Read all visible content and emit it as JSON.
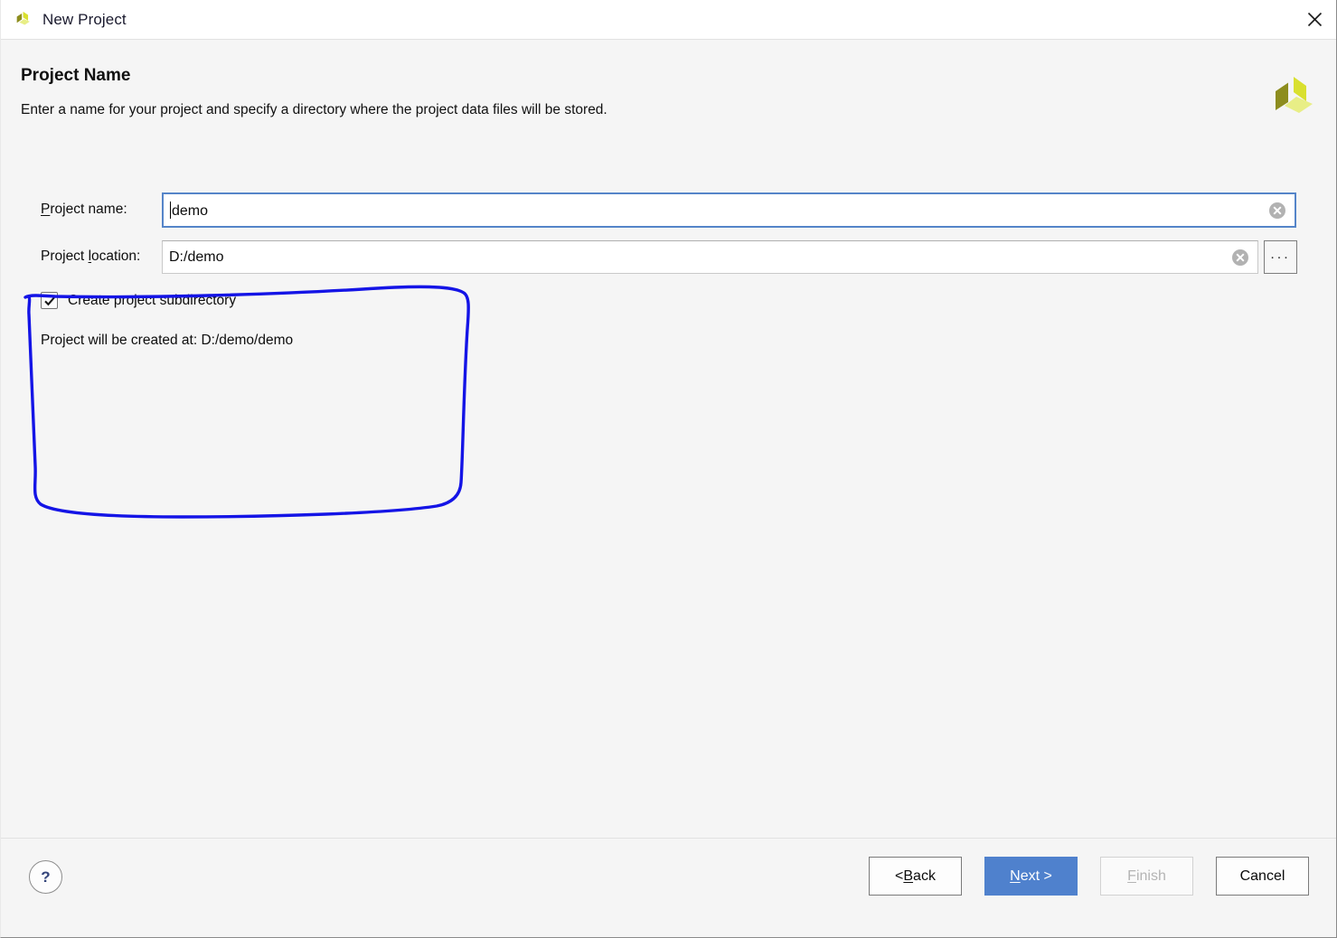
{
  "window": {
    "title": "New Project",
    "icon": "qt-logo-icon",
    "close_icon": "close-icon"
  },
  "header": {
    "title": "Project Name",
    "subtitle": "Enter a name for your project and specify a directory where the project data files will be stored.",
    "brand_icon": "qt-logo-icon"
  },
  "form": {
    "project_name": {
      "label_prefix": "P",
      "label_rest": "roject name:",
      "value": "demo",
      "placeholder": "",
      "clear_icon": "clear-circle-icon",
      "focused": true
    },
    "project_location": {
      "label_prefix_a": "Project ",
      "label_mnemonic": "l",
      "label_rest": "ocation:",
      "value": "D:/demo",
      "placeholder": "",
      "clear_icon": "clear-circle-icon",
      "browse_label": "...",
      "browse_icon": "ellipsis-icon"
    },
    "create_subdirectory": {
      "label": "Create project subdirectory",
      "checked": true,
      "check_icon": "checkmark-icon"
    },
    "created_at_text": "Project will be created at: D:/demo/demo"
  },
  "annotation": {
    "type": "hand-drawn-highlight",
    "color": "#1414e6",
    "shape": "rounded-rectangle-freehand"
  },
  "footer": {
    "help_label": "?",
    "help_icon": "question-mark-icon",
    "buttons": [
      {
        "name": "back",
        "text_before": "< ",
        "mnemonic": "B",
        "text_after": "ack",
        "style": "normal"
      },
      {
        "name": "next",
        "text_before": "",
        "mnemonic": "N",
        "text_after": "ext >",
        "style": "primary"
      },
      {
        "name": "finish",
        "text_before": "",
        "mnemonic": "F",
        "text_after": "inish",
        "style": "disabled"
      },
      {
        "name": "cancel",
        "text_before": "",
        "mnemonic": "",
        "text_after": "Cancel",
        "style": "normal"
      }
    ]
  },
  "colors": {
    "accent": "#4f81cd",
    "focus_border": "#5585c9",
    "annotation": "#1414e6",
    "background": "#f5f5f5",
    "titlebar": "#ffffff",
    "logo_dark": "#8d8d1e",
    "logo_mid": "#d9e02f",
    "logo_light": "#e8ee86"
  }
}
